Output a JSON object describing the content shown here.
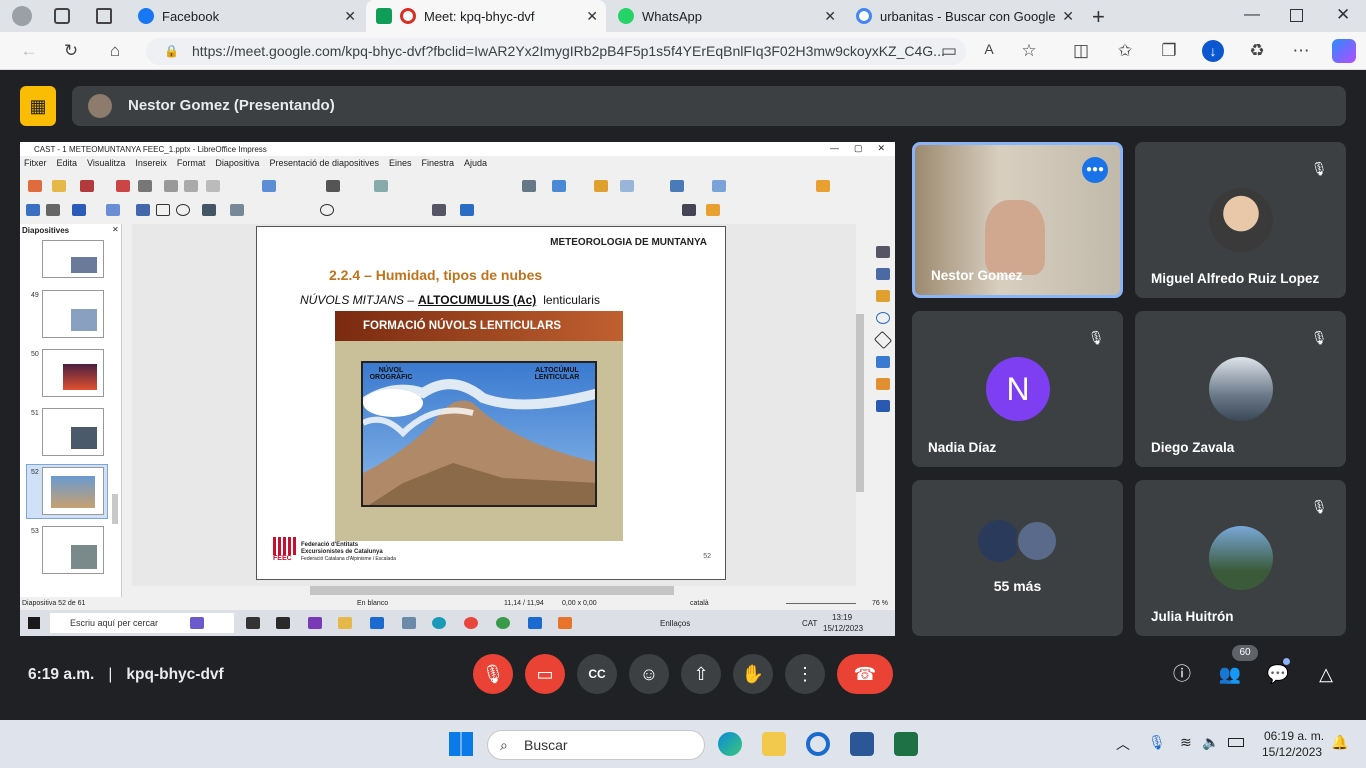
{
  "browser": {
    "tabs": [
      {
        "title": "Facebook",
        "icon": "facebook-icon",
        "color": "#1877f2"
      },
      {
        "title": "Meet: kpq-bhyc-dvf",
        "icon": "meet-icon",
        "color": "#ea4335"
      },
      {
        "title": "WhatsApp",
        "icon": "whatsapp-icon",
        "color": "#25d366"
      },
      {
        "title": "urbanitas - Buscar con Google",
        "icon": "google-icon",
        "color": "#4285f4"
      }
    ],
    "url": "https://meet.google.com/kpq-bhyc-dvf?fbclid=IwAR2Yx2ImygIRb2pB4F5p1s5f4YErEqBnlFIq3F02H3mw9ckoyxKZ_C4G..."
  },
  "meet": {
    "presenter_bar": "Nestor Gomez (Presentando)",
    "participants": [
      {
        "name": "Nestor Gomez",
        "speaking": true
      },
      {
        "name": "Miguel Alfredo Ruiz Lopez"
      },
      {
        "name": "Nadia Díaz",
        "initial": "N"
      },
      {
        "name": "Diego Zavala"
      },
      {
        "name": "55 más"
      },
      {
        "name": "Julia Huitrón"
      }
    ],
    "time": "6:19 a.m.",
    "meeting_code": "kpq-bhyc-dvf",
    "people_count": "60"
  },
  "impress": {
    "window_title": "CAST - 1 METEOMUNTANYA FEEC_1.pptx - LibreOffice Impress",
    "menu": [
      "Fitxer",
      "Edita",
      "Visualitza",
      "Insereix",
      "Format",
      "Diapositiva",
      "Presentació de diapositives",
      "Eines",
      "Finestra",
      "Ajuda"
    ],
    "panel_title": "Diapositives",
    "slide_numbers": [
      "49",
      "50",
      "51",
      "52",
      "53"
    ],
    "slide": {
      "header": "METEOROLOGIA DE MUNTANYA",
      "title": "2.2.4 – Humidad, tipos de nubes",
      "subtitle_a": "NÚVOLS MITJANS –",
      "subtitle_b": "ALTOCUMULUS (Ac)",
      "subtitle_c": "lenticularis",
      "figure_title": "FORMACIÓ NÚVOLS LENTICULARS",
      "label_left": "NÚVOL OROGRÀFIC",
      "label_right": "ALTOCÚMUL LENTICULAR",
      "org_line1": "Federació d'Entitats",
      "org_line2": "Excursionistes de Catalunya",
      "org_line3": "Federació Catalana d'Alpinisme i Escalada",
      "org_abbr": "FEEC",
      "page_number": "52"
    },
    "status": {
      "slide_of": "Diapositiva 52 de 61",
      "layout": "En blanco",
      "position": "11,14 / 11,94",
      "size": "0,00 x 0,00",
      "language": "català",
      "zoom": "76 %"
    },
    "remote_taskbar": {
      "search": "Escriu aquí per cercar",
      "links": "Enllaços",
      "lang": "CAT",
      "time": "13:19",
      "date": "15/12/2023"
    }
  },
  "taskbar": {
    "search": "Buscar",
    "time": "06:19 a. m.",
    "date": "15/12/2023"
  }
}
